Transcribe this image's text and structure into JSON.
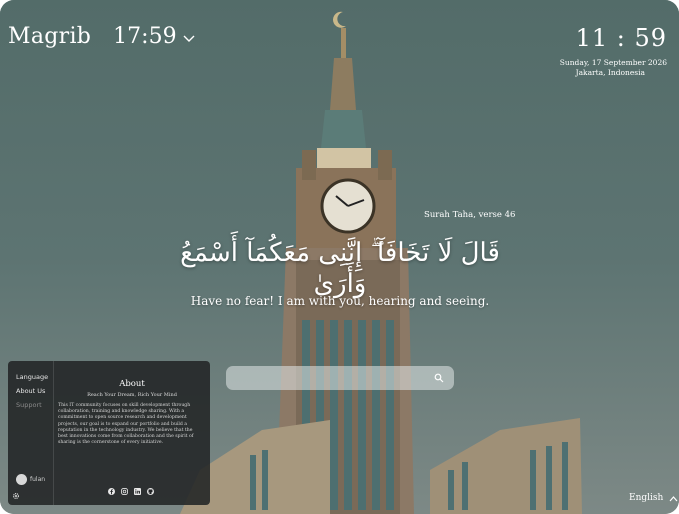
{
  "prayer": {
    "name": "Magrib",
    "time": "17:59"
  },
  "clock": {
    "time": "11 : 59",
    "date": "Sunday, 17 September 2026",
    "location": "Jakarta, Indonesia"
  },
  "verse": {
    "reference": "Surah Taha, verse 46",
    "arabic": "قَالَ لَا تَخَافَآ ۖ إِنَّنِى مَعَكُمَآ أَسْمَعُ وَأَرَىٰ",
    "translation": "Have no fear! I am with you, hearing and seeing."
  },
  "search": {
    "value": "",
    "placeholder": ""
  },
  "panel": {
    "nav": [
      "Language",
      "About Us",
      "Support"
    ],
    "user": "fulan",
    "title": "About",
    "subtitle": "Reach Your Dream, Rich Your Mind",
    "body": "This IT community focuses on skill development through collaboration, training and knowledge sharing. With a commitment to open source research and development projects, our goal is to expand our portfolio and build a reputation in the technology industry. We believe that the best innovations come from collaboration and the spirit of sharing is the cornerstone of every initiative.",
    "socials": [
      "facebook-icon",
      "instagram-icon",
      "linkedin-icon",
      "github-icon"
    ]
  },
  "language": {
    "current": "English"
  },
  "colors": {
    "panel": "#222426",
    "text": "#ffffff",
    "muted": "#8a8a8a"
  }
}
